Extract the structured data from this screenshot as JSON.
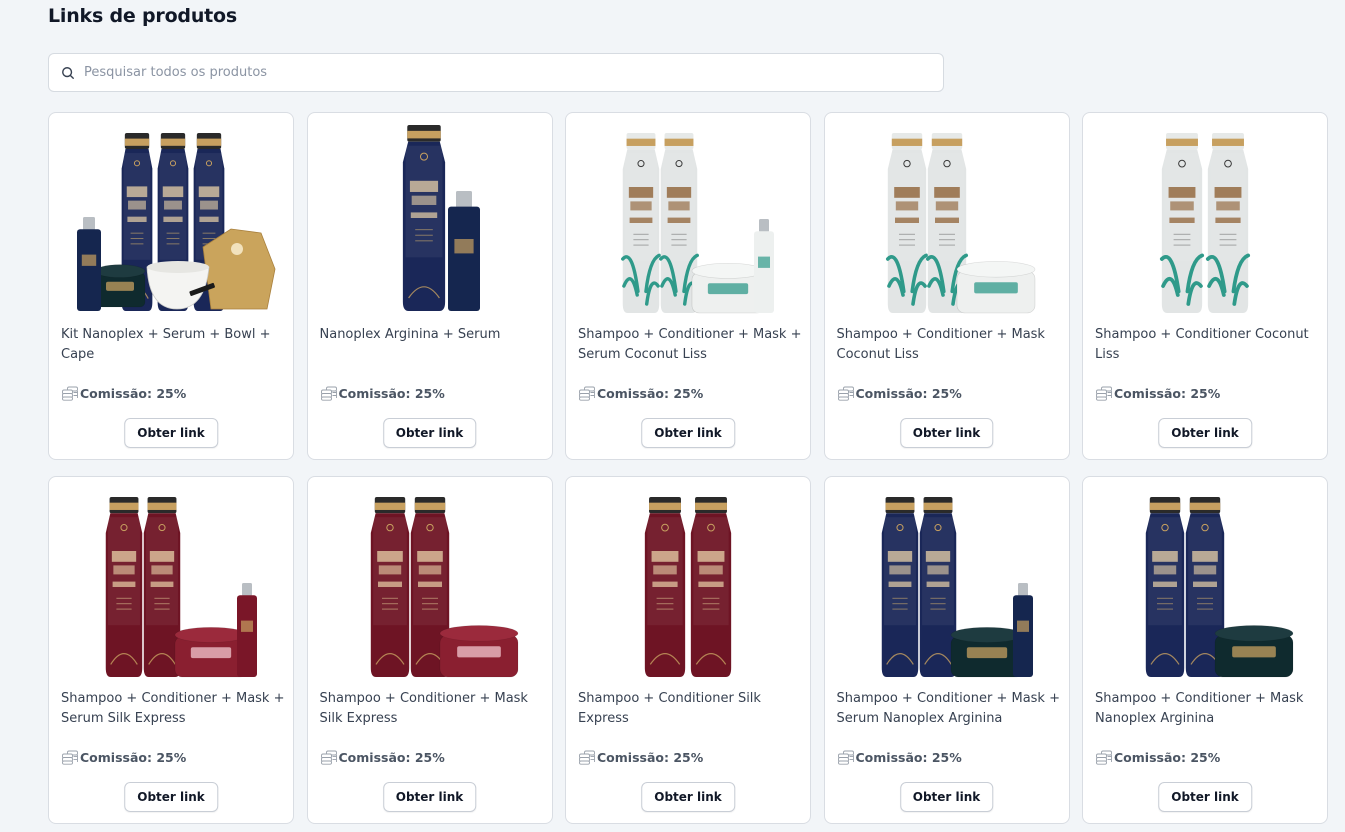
{
  "page": {
    "title": "Links de produtos"
  },
  "search": {
    "placeholder": "Pesquisar todos os produtos",
    "value": ""
  },
  "products": [
    {
      "name": "Kit Nanoplex + Serum + Bowl + Cape",
      "commission": "Comissão: 25%",
      "button": "Obter link",
      "image": {
        "bottles": 3,
        "variant": "navy-blue",
        "mask": true,
        "serum": true,
        "accessories": "bowl-cape"
      }
    },
    {
      "name": "Nanoplex Arginina + Serum",
      "commission": "Comissão: 25%",
      "button": "Obter link",
      "image": {
        "bottles": 1,
        "variant": "navy-blue",
        "mask": false,
        "serum": true
      }
    },
    {
      "name": "Shampoo + Conditioner + Mask + Serum Coconut Liss",
      "commission": "Comissão: 25%",
      "button": "Obter link",
      "image": {
        "bottles": 2,
        "variant": "white-palm",
        "mask": true,
        "serum": true
      }
    },
    {
      "name": "Shampoo + Conditioner + Mask Coconut Liss",
      "commission": "Comissão: 25%",
      "button": "Obter link",
      "image": {
        "bottles": 2,
        "variant": "white-palm",
        "mask": true,
        "serum": false
      }
    },
    {
      "name": "Shampoo + Conditioner Coconut Liss",
      "commission": "Comissão: 25%",
      "button": "Obter link",
      "image": {
        "bottles": 2,
        "variant": "white-palm",
        "mask": false,
        "serum": false
      }
    },
    {
      "name": "Shampoo + Conditioner + Mask + Serum Silk Express",
      "commission": "Comissão: 25%",
      "button": "Obter link",
      "image": {
        "bottles": 2,
        "variant": "burgundy",
        "mask": true,
        "serum": true
      }
    },
    {
      "name": "Shampoo + Conditioner + Mask Silk Express",
      "commission": "Comissão: 25%",
      "button": "Obter link",
      "image": {
        "bottles": 2,
        "variant": "burgundy",
        "mask": true,
        "serum": false
      }
    },
    {
      "name": "Shampoo + Conditioner Silk Express",
      "commission": "Comissão: 25%",
      "button": "Obter link",
      "image": {
        "bottles": 2,
        "variant": "burgundy",
        "mask": false,
        "serum": false
      }
    },
    {
      "name": "Shampoo + Conditioner + Mask + Serum Nanoplex Arginina",
      "commission": "Comissão: 25%",
      "button": "Obter link",
      "image": {
        "bottles": 2,
        "variant": "navy-blue",
        "mask": true,
        "serum": true
      }
    },
    {
      "name": "Shampoo + Conditioner + Mask Nanoplex Arginina",
      "commission": "Comissão: 25%",
      "button": "Obter link",
      "image": {
        "bottles": 2,
        "variant": "navy-blue",
        "mask": true,
        "serum": false
      }
    }
  ],
  "icons": {
    "search": "search-icon",
    "commission": "coins-icon"
  },
  "colors": {
    "page_background": "#f2f5f8",
    "card_border": "#d9dde3",
    "navy": "#1a2758",
    "burgundy": "#6e1424",
    "bottle_white": "#e2e5e5",
    "gold": "#c7a060",
    "palm_teal": "#2f9a8a"
  }
}
